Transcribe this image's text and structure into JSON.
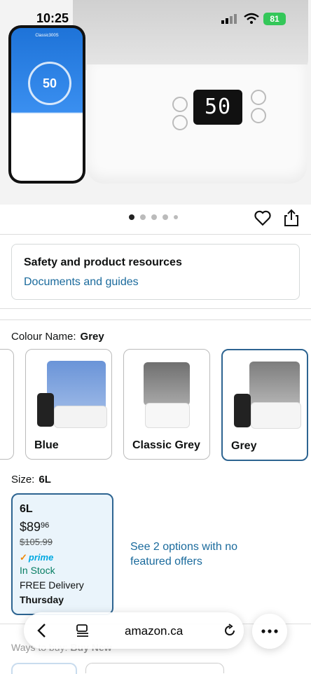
{
  "status_bar": {
    "time": "10:25",
    "battery": "81"
  },
  "hero": {
    "display_value": "50",
    "phone": {
      "title": "Classic300S",
      "value": "50"
    },
    "dot_count": 5,
    "active_dot": 0
  },
  "resources": {
    "title": "Safety and product resources",
    "link": "Documents and guides"
  },
  "colour": {
    "label": "Colour Name:",
    "selected": "Grey",
    "options": [
      "Blue",
      "Classic Grey",
      "Grey"
    ]
  },
  "size": {
    "label": "Size:",
    "selected": "6L",
    "card": {
      "name": "6L",
      "price_whole": "$89",
      "price_cents": "96",
      "list_price": "$105.99",
      "prime": "prime",
      "stock": "In Stock",
      "delivery": "FREE Delivery",
      "day": "Thursday"
    },
    "offers": "See 2 options with no featured offers"
  },
  "ways_to_buy": {
    "label": "Ways to buy:",
    "value": "Buy New"
  },
  "browser": {
    "url": "amazon.ca"
  },
  "colors": {
    "link": "#1a6a9c",
    "selected_border": "#2d6491",
    "in_stock": "#067d62"
  }
}
